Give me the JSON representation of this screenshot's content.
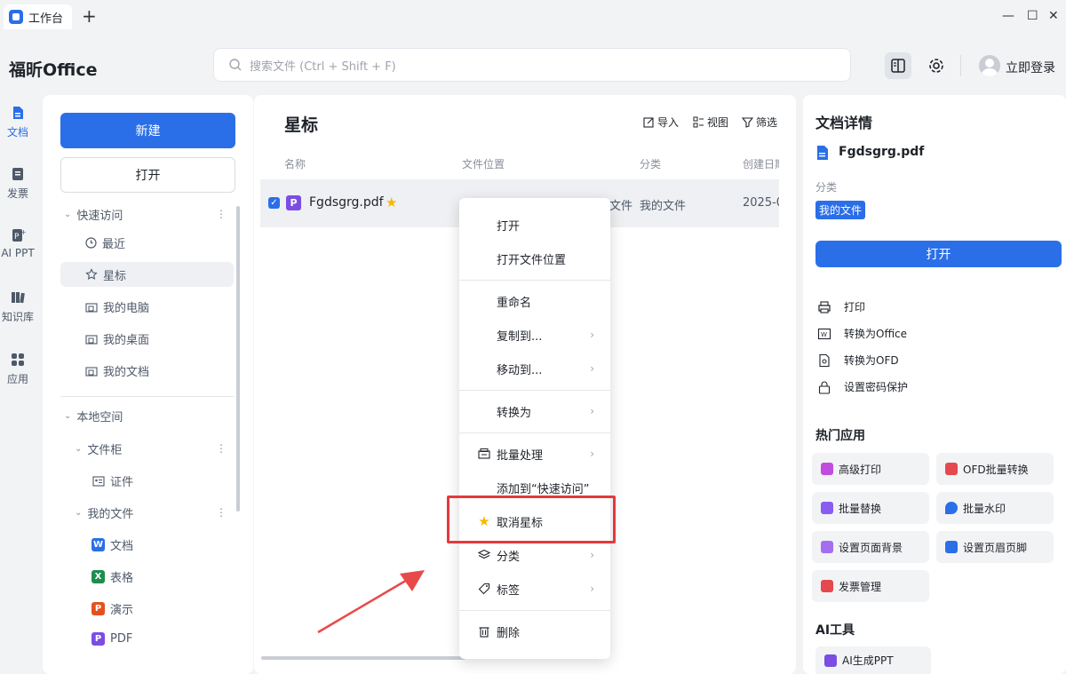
{
  "titlebar": {
    "tab_label": "工作台",
    "add_tab": "+",
    "min": "—",
    "max": "☐",
    "close": "✕"
  },
  "brand": "福昕Office",
  "search": {
    "placeholder": "搜索文件 (Ctrl + Shift + F)"
  },
  "account": {
    "login": "立即登录"
  },
  "rail": [
    {
      "label": "文档",
      "icon": "document-icon"
    },
    {
      "label": "发票",
      "icon": "invoice-icon"
    },
    {
      "label": "AI PPT",
      "icon": "ai-ppt-icon"
    },
    {
      "label": "知识库",
      "icon": "knowledge-book-icon"
    },
    {
      "label": "应用",
      "icon": "apps-grid-icon"
    }
  ],
  "sidebar": {
    "new_label": "新建",
    "open_label": "打开",
    "quick_access": "快速访问",
    "quick_items": [
      "最近",
      "星标",
      "我的电脑",
      "我的桌面",
      "我的文档"
    ],
    "local_space": "本地空间",
    "file_cabinet": "文件柜",
    "cabinet_items": [
      "证件"
    ],
    "my_files": "我的文件",
    "file_types": [
      "文档",
      "表格",
      "演示",
      "PDF"
    ],
    "dots": "⋮"
  },
  "main": {
    "title": "星标",
    "tools": {
      "import": "导入",
      "view": "视图",
      "filter": "筛选"
    },
    "columns": [
      "名称",
      "文件位置",
      "分类",
      "创建日期"
    ],
    "row": {
      "name": "Fgdsgrg.pdf",
      "location_tail": "文件",
      "category": "我的文件",
      "date": "2025-0"
    }
  },
  "context_menu": {
    "items": [
      "打开",
      "打开文件位置",
      "重命名",
      "复制到...",
      "移动到...",
      "转换为",
      "批量处理",
      "添加到“快速访问”",
      "取消星标",
      "分类",
      "标签",
      "删除"
    ],
    "arrow": "›"
  },
  "detail": {
    "title": "文档详情",
    "file_name": "Fgdsgrg.pdf",
    "category_label": "分类",
    "category_value": "我的文件",
    "open_label": "打开",
    "actions": [
      "打印",
      "转换为Office",
      "转换为OFD",
      "设置密码保护"
    ],
    "hot_apps_title": "热门应用",
    "hot_apps": [
      "高级打印",
      "OFD批量转换",
      "批量替换",
      "批量水印",
      "设置页面背景",
      "设置页眉页脚",
      "发票管理"
    ],
    "ai_tools_title": "AI工具",
    "ai_tools": [
      "AI生成PPT"
    ]
  },
  "colors": {
    "accent": "#2b6fe8",
    "highlight": "#e4393c",
    "star": "#f5b800",
    "pdf": "#7b4de3"
  }
}
